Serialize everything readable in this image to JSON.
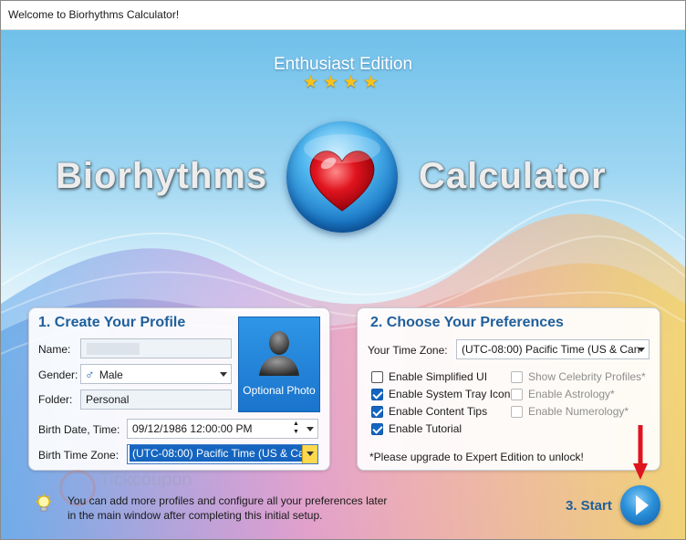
{
  "window": {
    "title": "Welcome to Biorhythms Calculator!"
  },
  "hero": {
    "edition": "Enthusiast Edition",
    "stars": 4,
    "brand_left": "Biorhythms",
    "brand_right": "Calculator",
    "logo_icon": "heart-orb-icon"
  },
  "profile": {
    "heading": "1. Create Your Profile",
    "name_label": "Name:",
    "name_value": "",
    "gender_label": "Gender:",
    "gender_value": "Male",
    "gender_icon": "male-icon",
    "folder_label": "Folder:",
    "folder_value": "Personal",
    "photo_label": "Optional Photo",
    "birth_date_label": "Birth Date, Time:",
    "birth_date_value": "09/12/1986 12:00:00 PM",
    "birth_tz_label": "Birth Time Zone:",
    "birth_tz_value": "(UTC-08:00) Pacific Time (US & Can"
  },
  "prefs": {
    "heading": "2. Choose Your Preferences",
    "tz_label": "Your Time Zone:",
    "tz_value": "(UTC-08:00) Pacific Time (US & Can",
    "left_options": [
      {
        "label": "Enable Simplified UI",
        "checked": false
      },
      {
        "label": "Enable System Tray Icon",
        "checked": true
      },
      {
        "label": "Enable Content Tips",
        "checked": true
      },
      {
        "label": "Enable Tutorial",
        "checked": true
      }
    ],
    "right_options": [
      {
        "label": "Show Celebrity Profiles*",
        "checked": false,
        "disabled": true
      },
      {
        "label": "Enable Astrology*",
        "checked": false,
        "disabled": true
      },
      {
        "label": "Enable Numerology*",
        "checked": false,
        "disabled": true
      }
    ],
    "upgrade_note": "*Please upgrade to Expert Edition to unlock!"
  },
  "footer": {
    "tip_line1": "You can add more profiles and configure all your preferences later",
    "tip_line2": "in the main window after completing this initial setup.",
    "start_label": "3. Start"
  },
  "watermark": "Tickcoupon",
  "colors": {
    "accent": "#1f5f9b",
    "checkbox": "#1565c0",
    "start_arrow": "#e0141e"
  }
}
